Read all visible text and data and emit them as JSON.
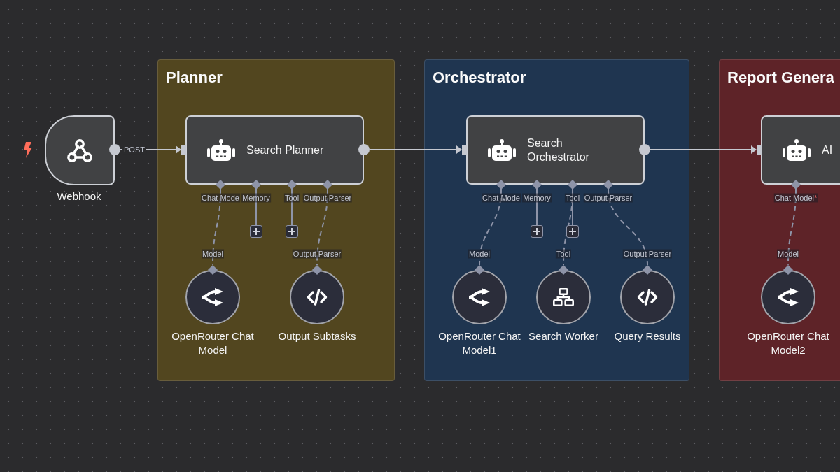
{
  "trigger": {
    "title": "Webhook",
    "output_label": "POST"
  },
  "groups": [
    {
      "title": "Planner",
      "color": "#52461f",
      "agent": {
        "title": "Search Planner",
        "ports": [
          {
            "label": "Chat Mode",
            "add_button": false,
            "attached": [
              {
                "title": "OpenRouter Chat Model",
                "kind": "model",
                "input_label": "Model"
              }
            ]
          },
          {
            "label": "Memory",
            "add_button": true
          },
          {
            "label": "Tool",
            "add_button": true
          },
          {
            "label": "Output Parser",
            "add_button": false,
            "attached": [
              {
                "title": "Output Subtasks",
                "kind": "parser",
                "input_label": "Output Parser"
              }
            ]
          }
        ]
      }
    },
    {
      "title": "Orchestrator",
      "color": "#1f3550",
      "agent": {
        "title": "Search Orchestrator",
        "ports": [
          {
            "label": "Chat Mode",
            "add_button": false,
            "attached": [
              {
                "title": "OpenRouter Chat Model1",
                "kind": "model",
                "input_label": "Model"
              }
            ]
          },
          {
            "label": "Memory",
            "add_button": true
          },
          {
            "label": "Tool",
            "add_button": true,
            "attached": [
              {
                "title": "Search Worker",
                "kind": "tool",
                "input_label": "Tool"
              }
            ]
          },
          {
            "label": "Output Parser",
            "add_button": false,
            "attached": [
              {
                "title": "Query Results",
                "kind": "parser",
                "input_label": "Output Parser"
              }
            ]
          }
        ]
      }
    },
    {
      "title": "Report Genera",
      "color": "#5e2328",
      "agent": {
        "title": "AI",
        "ports": [
          {
            "label": "Chat Model",
            "required_mark": "*",
            "add_button": false,
            "attached": [
              {
                "title": "OpenRouter Chat Model2",
                "kind": "model",
                "input_label": "Model"
              }
            ]
          }
        ]
      }
    }
  ]
}
